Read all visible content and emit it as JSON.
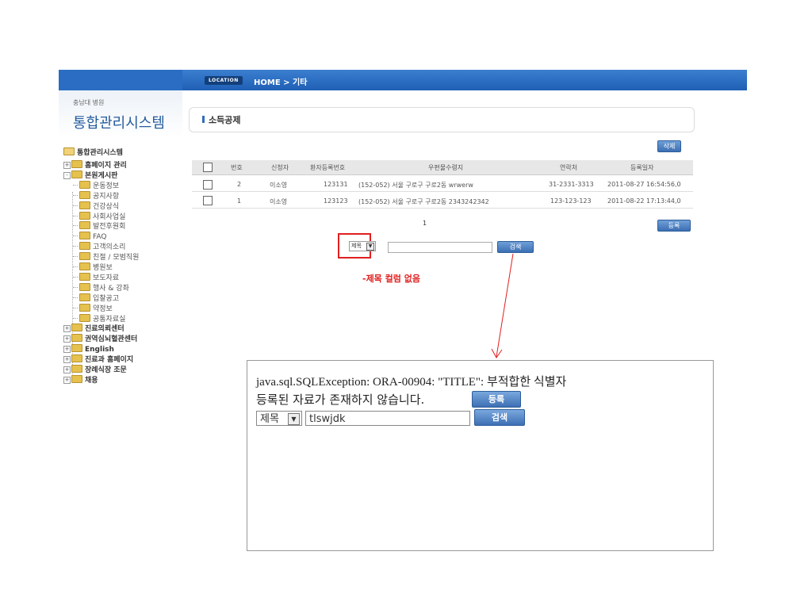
{
  "location": {
    "badge": "LOCATION",
    "path": "HOME > 기타"
  },
  "brand": {
    "small": "충남대 병원",
    "title": "통합관리시스템"
  },
  "tree": {
    "root": "통합관리시스템",
    "items": [
      {
        "label": "홈페이지 관리",
        "level": "top",
        "expand": "+"
      },
      {
        "label": "본원게시판",
        "level": "top",
        "expand": "-"
      },
      {
        "label": "운동정보",
        "level": "sub"
      },
      {
        "label": "공지사항",
        "level": "sub"
      },
      {
        "label": "건강상식",
        "level": "sub"
      },
      {
        "label": "사회사업실",
        "level": "sub"
      },
      {
        "label": "발전후원회",
        "level": "sub"
      },
      {
        "label": "FAQ",
        "level": "sub"
      },
      {
        "label": "고객의소리",
        "level": "sub"
      },
      {
        "label": "친절 / 모범직원",
        "level": "sub"
      },
      {
        "label": "병원보",
        "level": "sub"
      },
      {
        "label": "보도자료",
        "level": "sub"
      },
      {
        "label": "행사 & 강좌",
        "level": "sub"
      },
      {
        "label": "입찰공고",
        "level": "sub"
      },
      {
        "label": "약정보",
        "level": "sub"
      },
      {
        "label": "공통자료실",
        "level": "sub"
      },
      {
        "label": "진료의뢰센터",
        "level": "top",
        "expand": "+"
      },
      {
        "label": "권역심뇌혈관센터",
        "level": "top",
        "expand": "+"
      },
      {
        "label": "English",
        "level": "top",
        "expand": "+"
      },
      {
        "label": "진료과 홈페이지",
        "level": "top",
        "expand": "+"
      },
      {
        "label": "장례식장 조문",
        "level": "top",
        "expand": "+"
      },
      {
        "label": "채용",
        "level": "top",
        "expand": "+"
      }
    ]
  },
  "section": {
    "title": "소득공제"
  },
  "buttons": {
    "delete": "삭제",
    "register": "등록",
    "search": "검색"
  },
  "table": {
    "headers": [
      "번호",
      "신청자",
      "환자등록번호",
      "우편물수령지",
      "연락처",
      "등록일자"
    ],
    "rows": [
      {
        "no": "2",
        "name": "이소영",
        "patient_no": "123131",
        "address": "(152-052) 서울 구로구 구로2동 wrwerw",
        "phone": "31-2331-3313",
        "date": "2011-08-27 16:54:56,0"
      },
      {
        "no": "1",
        "name": "이소영",
        "patient_no": "123123",
        "address": "(152-052) 서울 구로구 구로2동 2343242342",
        "phone": "123-123-123",
        "date": "2011-08-22 17:13:44,0"
      }
    ]
  },
  "pagination": {
    "current": "1"
  },
  "search": {
    "selected": "제목",
    "value": ""
  },
  "annotation": "-제목 컬럼 없음",
  "error_panel": {
    "exception": "java.sql.SQLException: ORA-00904: \"TITLE\": 부적합한 식별자",
    "message": "등록된 자료가 존재하지 않습니다.",
    "register_label": "등록",
    "search_label": "검색",
    "select_value": "제목",
    "input_value": "tlswjdk"
  },
  "colors": {
    "topbar": "#1f5fb5",
    "accent": "#2f6dbd",
    "highlight": "#e02020"
  }
}
